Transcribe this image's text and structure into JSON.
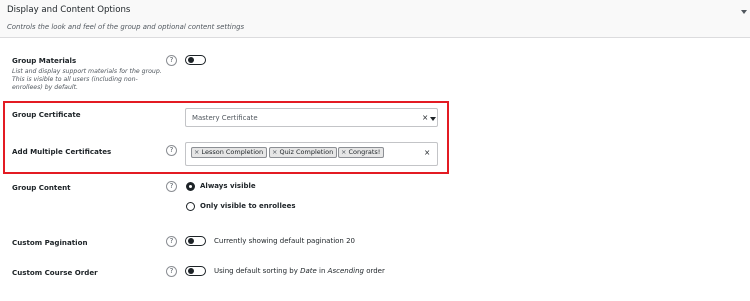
{
  "panel": {
    "title": "Display and Content Options",
    "subtitle": "Controls the look and feel of the group and optional content settings"
  },
  "fields": {
    "group_materials": {
      "label": "Group Materials",
      "description": "List and display support materials for the group. This is visible to all users (including non-enrollees) by default.",
      "enabled": false
    },
    "group_certificate": {
      "label": "Group Certificate",
      "selected": "Mastery Certificate",
      "clear_symbol": "×"
    },
    "multiple_certificates": {
      "label": "Add Multiple Certificates",
      "tags": [
        "Lesson Completion",
        "Quiz Completion",
        "Congrats!"
      ],
      "tag_remove_symbol": "×",
      "clear_symbol": "×"
    },
    "group_content": {
      "label": "Group Content",
      "options": [
        "Always visible",
        "Only visible to enrollees"
      ],
      "selected_index": 0
    },
    "custom_pagination": {
      "label": "Custom Pagination",
      "status_text": "Currently showing default pagination 20",
      "enabled": false
    },
    "custom_course_order": {
      "label": "Custom Course Order",
      "status_prefix": "Using default sorting by ",
      "status_sort_field": "Date",
      "status_middle": " in ",
      "status_sort_dir": "Ascending",
      "status_suffix": " order",
      "enabled": false
    }
  },
  "help_symbol": "?",
  "colors": {
    "highlight": "#e31b23",
    "header_bg": "#f9f9f9",
    "text": "#1d2327"
  }
}
